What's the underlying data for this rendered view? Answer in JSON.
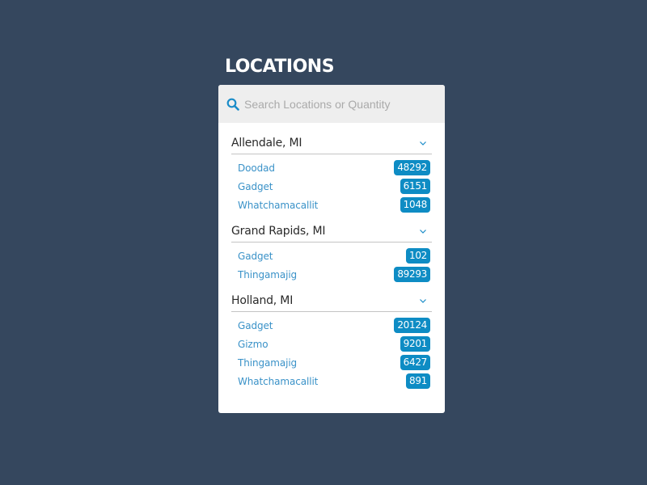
{
  "header": {
    "title": "LOCATIONS"
  },
  "search": {
    "placeholder": "Search Locations or Quantity",
    "value": ""
  },
  "colors": {
    "background": "#35475e",
    "accent": "#0e8cc4",
    "link": "#3a92c8"
  },
  "icons": {
    "search": "search-icon",
    "expand": "chevron-down-icon"
  },
  "locations": [
    {
      "name": "Allendale, MI",
      "items": [
        {
          "label": "Doodad",
          "count": "48292"
        },
        {
          "label": "Gadget",
          "count": "6151"
        },
        {
          "label": "Whatchamacallit",
          "count": "1048"
        }
      ]
    },
    {
      "name": "Grand Rapids, MI",
      "items": [
        {
          "label": "Gadget",
          "count": "102"
        },
        {
          "label": "Thingamajig",
          "count": "89293"
        }
      ]
    },
    {
      "name": "Holland, MI",
      "items": [
        {
          "label": "Gadget",
          "count": "20124"
        },
        {
          "label": "Gizmo",
          "count": "9201"
        },
        {
          "label": "Thingamajig",
          "count": "6427"
        },
        {
          "label": "Whatchamacallit",
          "count": "891"
        }
      ]
    }
  ]
}
